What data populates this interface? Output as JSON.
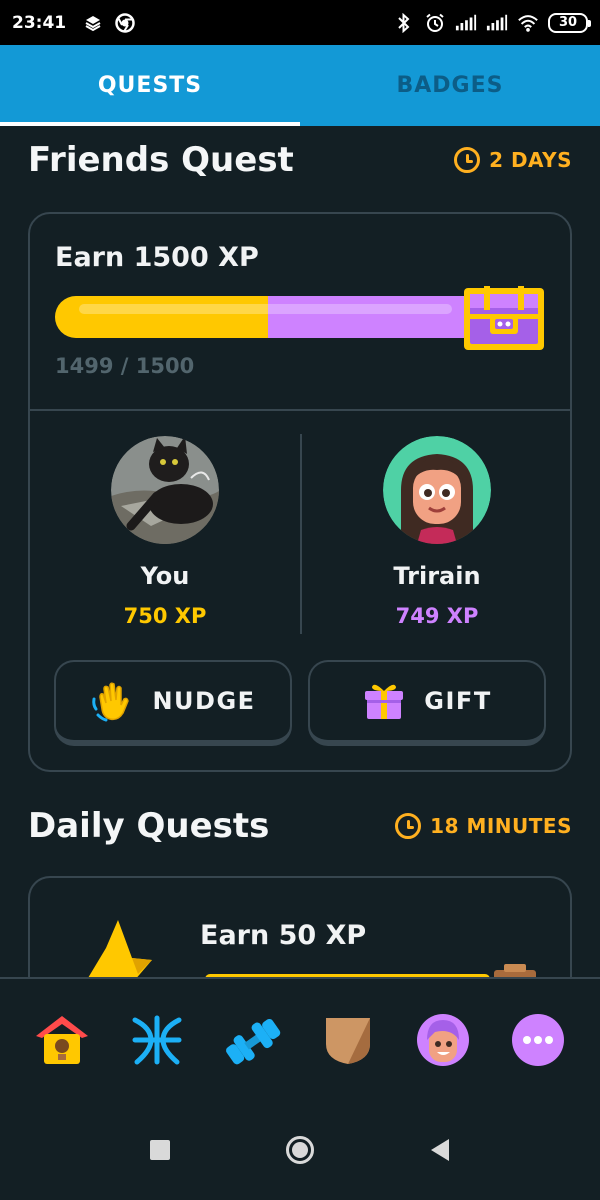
{
  "status_bar": {
    "time": "23:41",
    "left_icons": [
      "layers-icon",
      "chrome-icon"
    ],
    "right_icons": [
      "bluetooth-icon",
      "alarm-icon",
      "signal-icon",
      "signal-icon",
      "wifi-icon"
    ],
    "battery": "30"
  },
  "tabs": [
    {
      "label": "QUESTS",
      "active": true
    },
    {
      "label": "BADGES",
      "active": false
    }
  ],
  "friends_quest": {
    "title": "Friends Quest",
    "time_left": "2 DAYS",
    "goal": "Earn 1500 XP",
    "progress_text": "1499 / 1500",
    "progress": {
      "you_xp": 750,
      "friend_xp": 749,
      "target_xp": 1500
    },
    "you": {
      "name": "You",
      "xp": "750 XP"
    },
    "friend": {
      "name": "Trirain",
      "xp": "749 XP"
    },
    "nudge_label": "NUDGE",
    "gift_label": "GIFT"
  },
  "daily_quests": {
    "title": "Daily Quests",
    "time_left": "18 MINUTES",
    "first_goal": "Earn 50 XP"
  },
  "bottom_nav": [
    "home-icon",
    "alphabet-icon",
    "dumbbell-icon",
    "league-shield-icon",
    "profile-icon",
    "more-icon"
  ],
  "colors": {
    "background": "#131f24",
    "tab_bar": "#1399d6",
    "accent_orange": "#ffb020",
    "xp_yellow": "#ffc800",
    "friend_purple": "#ce82ff",
    "card_border": "#37464f"
  }
}
